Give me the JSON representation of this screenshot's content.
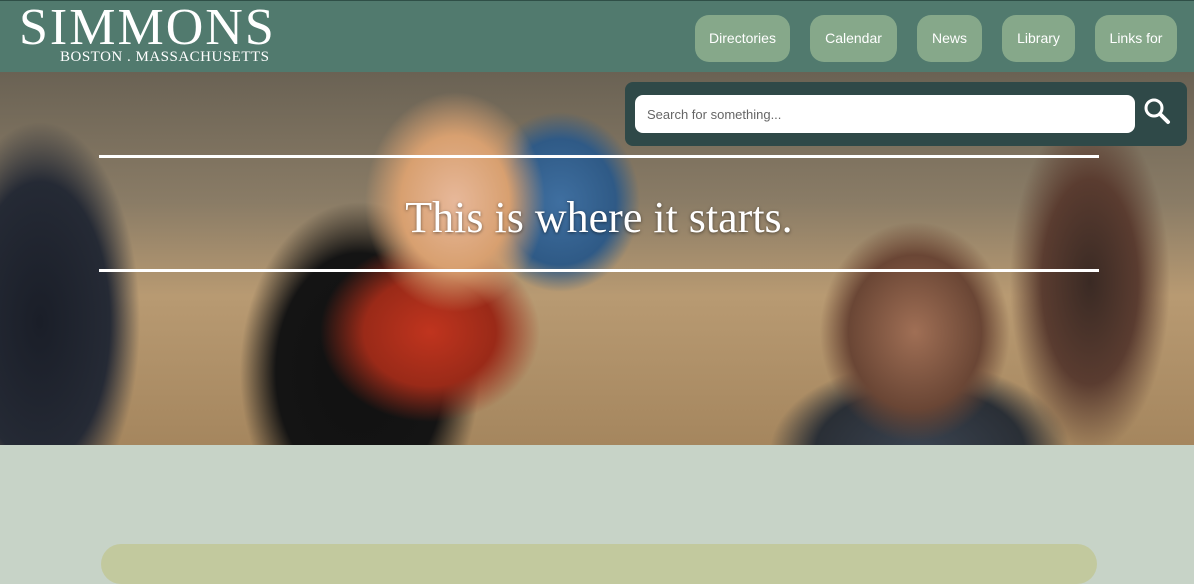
{
  "logo": {
    "title": "SIMMONS",
    "subtitle": "BOSTON . MASSACHUSETTS"
  },
  "nav": [
    {
      "label": "Directories"
    },
    {
      "label": "Calendar"
    },
    {
      "label": "News"
    },
    {
      "label": "Library"
    },
    {
      "label": "Links for"
    }
  ],
  "search": {
    "placeholder": "Search for something...",
    "value": ""
  },
  "hero": {
    "tagline": "This is where it starts."
  },
  "colors": {
    "header": "#517a6e",
    "nav_button": "#86a88a",
    "search_panel": "#2f4948",
    "page_background": "#c7d3c7",
    "card": "#c2c99e"
  },
  "icons": {
    "search": "search-icon"
  }
}
